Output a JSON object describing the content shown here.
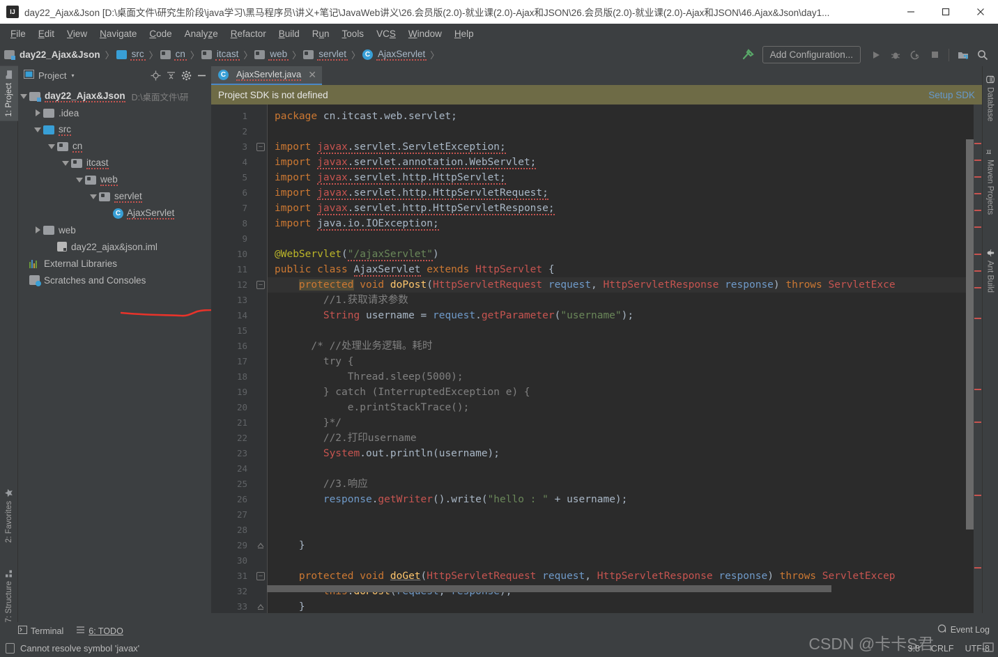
{
  "window": {
    "title": "day22_Ajax&Json [D:\\桌面文件\\研究生阶段\\java学习\\黑马程序员\\讲义+笔记\\JavaWeb讲义\\26.会员版(2.0)-就业课(2.0)-Ajax和JSON\\26.会员版(2.0)-就业课(2.0)-Ajax和JSON\\46.Ajax&Json\\day1...",
    "logo": "intellij-idea-logo",
    "minimize": "−",
    "maximize": "□",
    "close": "✕"
  },
  "menubar": {
    "items": [
      "File",
      "Edit",
      "View",
      "Navigate",
      "Code",
      "Analyze",
      "Refactor",
      "Build",
      "Run",
      "Tools",
      "VCS",
      "Window",
      "Help"
    ]
  },
  "navbar": {
    "crumbs": [
      {
        "label": "day22_Ajax&Json",
        "icon": "module-icon"
      },
      {
        "label": "src",
        "icon": "source-folder-icon"
      },
      {
        "label": "cn",
        "icon": "package-icon"
      },
      {
        "label": "itcast",
        "icon": "package-icon"
      },
      {
        "label": "web",
        "icon": "package-icon"
      },
      {
        "label": "servlet",
        "icon": "package-icon"
      },
      {
        "label": "AjaxServlet",
        "icon": "class-icon"
      }
    ],
    "separator": "〉",
    "add_configuration": "Add Configuration...",
    "icons": [
      "build-hammer-icon",
      "run-icon",
      "debug-icon",
      "run-with-coverage-icon",
      "stop-icon",
      "project-structure-icon",
      "search-icon"
    ]
  },
  "left_strip": {
    "tabs": [
      {
        "label": "1: Project",
        "icon": "project-folder-icon",
        "active": true
      },
      {
        "label": "2: Favorites",
        "icon": "star-icon",
        "active": false
      },
      {
        "label": "7: Structure",
        "icon": "structure-icon",
        "active": false
      }
    ]
  },
  "right_strip": {
    "tabs": [
      {
        "label": "Database",
        "icon": "database-icon"
      },
      {
        "label": "Maven Projects",
        "icon": "maven-icon"
      },
      {
        "label": "Ant Build",
        "icon": "ant-icon"
      }
    ]
  },
  "project_panel": {
    "title": "Project",
    "caret": "▾",
    "toolbar_icons": [
      "locate-icon",
      "collapse-all-icon",
      "settings-gear-icon",
      "hide-icon"
    ],
    "tree": [
      {
        "indent": 0,
        "twisty": "down",
        "icon": "module-icon",
        "label": "day22_Ajax&Json",
        "bold": true,
        "path": "D:\\桌面文件\\研",
        "wavy": true
      },
      {
        "indent": 1,
        "twisty": "right",
        "icon": "folder-gray-icon",
        "label": ".idea",
        "bold": false,
        "path": "",
        "wavy": false
      },
      {
        "indent": 1,
        "twisty": "down",
        "icon": "source-folder-icon",
        "label": "src",
        "bold": false,
        "path": "",
        "wavy": true
      },
      {
        "indent": 2,
        "twisty": "down",
        "icon": "package-icon",
        "label": "cn",
        "bold": false,
        "path": "",
        "wavy": true
      },
      {
        "indent": 3,
        "twisty": "down",
        "icon": "package-icon",
        "label": "itcast",
        "bold": false,
        "path": "",
        "wavy": true
      },
      {
        "indent": 4,
        "twisty": "down",
        "icon": "package-icon",
        "label": "web",
        "bold": false,
        "path": "",
        "wavy": true
      },
      {
        "indent": 5,
        "twisty": "down",
        "icon": "package-icon",
        "label": "servlet",
        "bold": false,
        "path": "",
        "wavy": true
      },
      {
        "indent": 6,
        "twisty": "none",
        "icon": "class-icon",
        "label": "AjaxServlet",
        "bold": false,
        "path": "",
        "wavy": true
      },
      {
        "indent": 1,
        "twisty": "right",
        "icon": "folder-gray-icon",
        "label": "web",
        "bold": false,
        "path": "",
        "wavy": false
      },
      {
        "indent": 2,
        "twisty": "none",
        "icon": "iml-file-icon",
        "label": "day22_ajax&json.iml",
        "bold": false,
        "path": "",
        "wavy": false
      },
      {
        "indent": 0,
        "twisty": "none",
        "icon": "external-libraries-icon",
        "label": "External Libraries",
        "bold": false,
        "path": "",
        "wavy": false
      },
      {
        "indent": 0,
        "twisty": "none",
        "icon": "scratches-icon",
        "label": "Scratches and Consoles",
        "bold": false,
        "path": "",
        "wavy": false
      }
    ],
    "annotation": "red-underline-annotation"
  },
  "editor": {
    "tab": {
      "label": "AjaxServlet.java",
      "icon": "class-icon",
      "close": "✕"
    },
    "notification": {
      "message": "Project SDK is not defined",
      "action": "Setup SDK",
      "bg": "#6e6b46",
      "link_color": "#6699cc"
    },
    "error_badge": "!",
    "lines": [
      {
        "n": 1,
        "fold": "",
        "html": "<span class=\"kw\">package</span> cn.itcast.web.servlet;"
      },
      {
        "n": 2,
        "fold": "",
        "html": ""
      },
      {
        "n": 3,
        "fold": "minus",
        "html": "<span class=\"kw\">import</span> <span class=\"err-u\"><span class=\"cls-err\">javax</span>.servlet.ServletException;</span>"
      },
      {
        "n": 4,
        "fold": "",
        "html": "<span class=\"kw\">import</span> <span class=\"err-u\"><span class=\"cls-err\">javax</span>.servlet.annotation.WebServlet;</span>"
      },
      {
        "n": 5,
        "fold": "",
        "html": "<span class=\"kw\">import</span> <span class=\"err-u\"><span class=\"cls-err\">javax</span>.servlet.http.HttpServlet;</span>"
      },
      {
        "n": 6,
        "fold": "",
        "html": "<span class=\"kw\">import</span> <span class=\"err-u\"><span class=\"cls-err\">javax</span>.servlet.http.HttpServletRequest;</span>"
      },
      {
        "n": 7,
        "fold": "",
        "html": "<span class=\"kw\">import</span> <span class=\"err-u\"><span class=\"cls-err\">javax</span>.servlet.http.HttpServletResponse;</span>"
      },
      {
        "n": 8,
        "fold": "",
        "html": "<span class=\"kw\">import</span> <span class=\"err-u\">java.io.IOException;</span>"
      },
      {
        "n": 9,
        "fold": "",
        "html": ""
      },
      {
        "n": 10,
        "fold": "",
        "html": "<span class=\"annot\">@WebServlet</span>(<span class=\"str err-u\">\"/ajaxServlet\"</span>)"
      },
      {
        "n": 11,
        "fold": "",
        "html": "<span class=\"kw\">public class</span> <span class=\"err-u\">AjaxServlet</span> <span class=\"kw\">extends</span> <span class=\"cls-err\">HttpServlet</span> {"
      },
      {
        "n": 12,
        "fold": "minus",
        "hl": true,
        "html": "    <span class=\"kw hl-tok\">protected</span> <span class=\"kw\">void</span> <span class=\"mth\">doPost</span>(<span class=\"cls-err\">HttpServletRequest</span> <span class=\"param\">request</span>, <span class=\"cls-err\">HttpServletResponse</span> <span class=\"param\">response</span>) <span class=\"kw\">throws</span> <span class=\"cls-err\">ServletExce</span>"
      },
      {
        "n": 13,
        "fold": "",
        "html": "        <span class=\"cmt\">//1.获取请求参数</span>"
      },
      {
        "n": 14,
        "fold": "",
        "html": "        <span class=\"cls-err\">String</span> username = <span class=\"param\">request</span>.<span class=\"cls-err\">getParameter</span>(<span class=\"str\">\"username\"</span>);"
      },
      {
        "n": 15,
        "fold": "",
        "html": ""
      },
      {
        "n": 16,
        "fold": "",
        "html": "      <span class=\"cmt\">/* //处理业务逻辑。耗时</span>"
      },
      {
        "n": 17,
        "fold": "",
        "html": "        <span class=\"cmt\">try {</span>"
      },
      {
        "n": 18,
        "fold": "",
        "html": "            <span class=\"cmt\">Thread.sleep(5000);</span>"
      },
      {
        "n": 19,
        "fold": "",
        "html": "        <span class=\"cmt\">} catch (InterruptedException e) {</span>"
      },
      {
        "n": 20,
        "fold": "",
        "html": "            <span class=\"cmt\">e.printStackTrace();</span>"
      },
      {
        "n": 21,
        "fold": "",
        "html": "        <span class=\"cmt\">}*/</span>"
      },
      {
        "n": 22,
        "fold": "",
        "html": "        <span class=\"cmt\">//2.打印username</span>"
      },
      {
        "n": 23,
        "fold": "",
        "html": "        <span class=\"cls-err\">System</span>.out.println(username);"
      },
      {
        "n": 24,
        "fold": "",
        "html": ""
      },
      {
        "n": 25,
        "fold": "",
        "html": "        <span class=\"cmt\">//3.响应</span>"
      },
      {
        "n": 26,
        "fold": "",
        "html": "        <span class=\"param\">response</span>.<span class=\"cls-err\">getWriter</span>().write(<span class=\"str\">\"hello : \"</span> + username);"
      },
      {
        "n": 27,
        "fold": "",
        "html": ""
      },
      {
        "n": 28,
        "fold": "",
        "html": ""
      },
      {
        "n": 29,
        "fold": "plus",
        "html": "    }"
      },
      {
        "n": 30,
        "fold": "",
        "html": ""
      },
      {
        "n": 31,
        "fold": "minus",
        "html": "    <span class=\"kw\">protected</span> <span class=\"kw\">void</span> <span class=\"mth warn-u\">doGet</span>(<span class=\"cls-err\">HttpServletRequest</span> <span class=\"param\">request</span>, <span class=\"cls-err\">HttpServletResponse</span> <span class=\"param\">response</span>) <span class=\"kw\">throws</span> <span class=\"cls-err\">ServletExcep</span>"
      },
      {
        "n": 32,
        "fold": "",
        "html": "        <span class=\"kw\">this</span>.<span class=\"mth\">doPost</span>(<span class=\"param\">request</span>, <span class=\"param\">response</span>);"
      },
      {
        "n": 33,
        "fold": "plus",
        "html": "    }"
      }
    ]
  },
  "bottom_strip": {
    "tabs": [
      {
        "label": "Terminal",
        "icon": "terminal-icon"
      },
      {
        "label": "6: TODO",
        "icon": "todo-list-icon"
      }
    ]
  },
  "statusbar": {
    "message": "Cannot resolve symbol 'javax'",
    "caret_position": "3:8",
    "line_separator": "CRLF",
    "encoding": "UTF-8",
    "event_log": "Event Log"
  },
  "watermark": {
    "text": "CSDN @卡卡S君"
  },
  "colors": {
    "panel_bg": "#3c3f41",
    "editor_bg": "#2b2b2b",
    "gutter_bg": "#313335",
    "accent_blue": "#4a88c7",
    "error_red": "#c75450",
    "notification_bg": "#6e6b46",
    "link_blue": "#6699cc",
    "annotation_red": "#e8332a"
  }
}
